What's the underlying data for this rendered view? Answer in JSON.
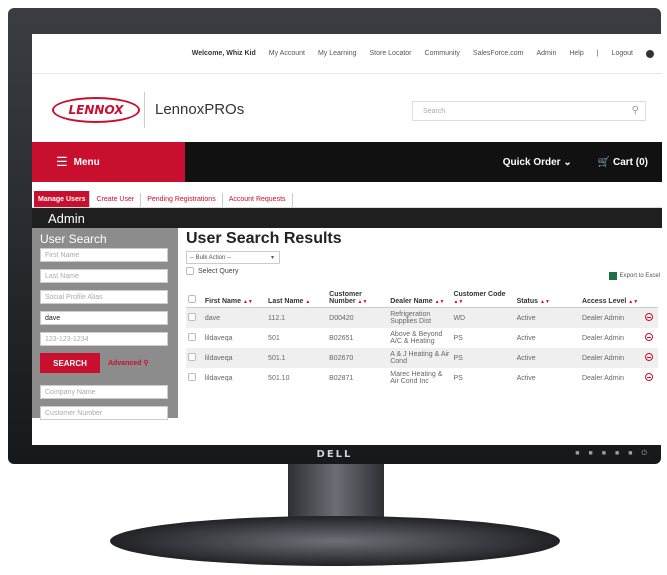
{
  "monitor": {
    "brand": "DELL"
  },
  "utility": {
    "welcome": "Welcome, Whiz Kid",
    "links": [
      "My Account",
      "My Learning",
      "Store Locator",
      "Community",
      "SalesForce.com",
      "Admin",
      "Help",
      "|",
      "Logout"
    ]
  },
  "header": {
    "logo_text": "LENNOX",
    "product": "LennoxPROs",
    "search_placeholder": "Search"
  },
  "nav": {
    "menu": "Menu",
    "quick_order": "Quick Order",
    "cart": "Cart (0)"
  },
  "tabs": [
    "Manage Users",
    "Create User",
    "Pending Registrations",
    "Account Requests"
  ],
  "admin_title": "Admin",
  "sidebar": {
    "title": "User Search",
    "fields": [
      {
        "placeholder": "First Name",
        "value": ""
      },
      {
        "placeholder": "Last Name",
        "value": ""
      },
      {
        "placeholder": "Social Profile Alias",
        "value": ""
      },
      {
        "placeholder": "",
        "value": "dave"
      },
      {
        "placeholder": "123-123-1234",
        "value": ""
      }
    ],
    "search_button": "SEARCH",
    "advanced": "Advanced",
    "fields2": [
      {
        "placeholder": "Company Name"
      },
      {
        "placeholder": "Customer Number"
      }
    ]
  },
  "results": {
    "title": "User Search Results",
    "bulk_action": "-- Bulk Action --",
    "select_query": "Select Query",
    "export": "Export to Excel",
    "columns": [
      "First Name",
      "Last Name",
      "Customer Number",
      "Dealer Name",
      "Customer Code",
      "Status",
      "Access Level"
    ],
    "rows": [
      [
        "dave",
        "112.1",
        "D00420",
        "Refrigeration Supplies Dist",
        "WD",
        "Active",
        "Dealer Admin"
      ],
      [
        "lildaveqa",
        "501",
        "B02651",
        "Above & Beyond A/C & Heating",
        "PS",
        "Active",
        "Dealer Admin"
      ],
      [
        "lildaveqa",
        "501.1",
        "B02670",
        "A & J Heating & Air Cond",
        "PS",
        "Active",
        "Dealer Admin"
      ],
      [
        "lildaveqa",
        "501.10",
        "B02871",
        "Marec Heating & Air Cond Inc",
        "PS",
        "Active",
        "Dealer Admin"
      ]
    ]
  }
}
